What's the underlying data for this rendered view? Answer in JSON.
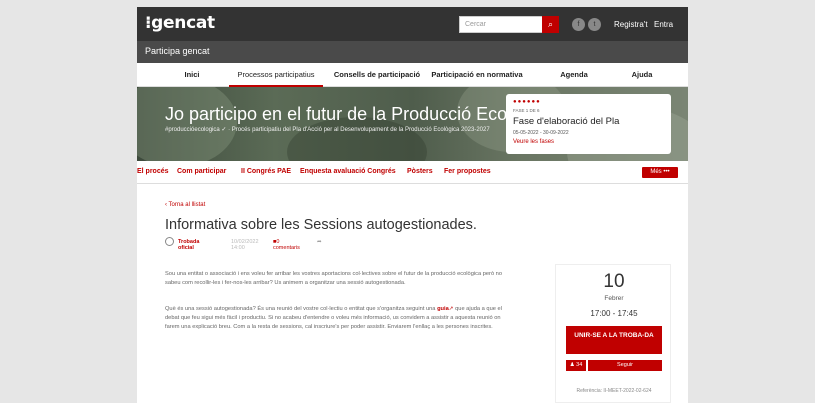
{
  "header": {
    "logo": "gencat",
    "search_placeholder": "Cercar",
    "register": "Registra't",
    "login": "Entra"
  },
  "subheader": {
    "title": "Participa gencat"
  },
  "nav": [
    "Inici",
    "Processos participatius",
    "Consells de participació",
    "Participació en normativa",
    "Agenda",
    "Ajuda"
  ],
  "hero": {
    "title": "Jo participo en el futur de la Producció Ecològica",
    "subtitle": "#produccióecologica ✓ · Procés participatiu del Pla d'Acció per al Desenvolupament de la Producció Ecològica 2023-2027",
    "phase": {
      "dots": "●●●●●●",
      "number": "FASE 1 DE 6",
      "name": "Fase d'elaboració del Pla",
      "dates": "05-05-2022 - 30-09-2022",
      "link": "Veure les fases"
    }
  },
  "subnav": {
    "items": [
      "El procés",
      "Com participar",
      "II Congrés PAE",
      "Enquesta avaluació Congrés",
      "Pòsters",
      "Fer propostes"
    ],
    "more": "Més •••"
  },
  "article": {
    "back": "‹ Torna al llistat",
    "title": "Informativa sobre les Sessions autogestionades.",
    "author": "Trobada oficial",
    "date": "10/02/2022 14:00",
    "comments": "0 comentaris",
    "paragraph1": "Sou una entitat o associació i ens voleu fer arribar les vostres aportacions col·lectives sobre el futur de la producció ecològica però no sabeu com recollir-les i fer-nos-les arribar? Us animem a organitzar una sessió autogestionada.",
    "paragraph2_a": "Què és una sessió autogestionada? És una reunió del vostre col·lectiu o entitat que s'organitza seguint una ",
    "paragraph2_link": "guia",
    "paragraph2_b": " que ajuda a que el debat que feu sigui més fàcil i productiu. Si no acabeu d'entendre o voleu més informació, us convidem a assistir a aquesta reunió on farem una explicació breu. Com a la resta de sessions, cal inscriure's per poder assistir. Enviarem l'enllaç a les persones inscrites."
  },
  "event": {
    "day": "10",
    "month": "Febrer",
    "time": "17:00 - 17:45",
    "join": "UNIR-SE A LA TROBA-DA",
    "count": "34",
    "follow": "Seguir",
    "reference": "Referència: II-MEET-2022-02-624"
  },
  "colors": {
    "accent": "#c00000",
    "topbar": "#333333"
  }
}
